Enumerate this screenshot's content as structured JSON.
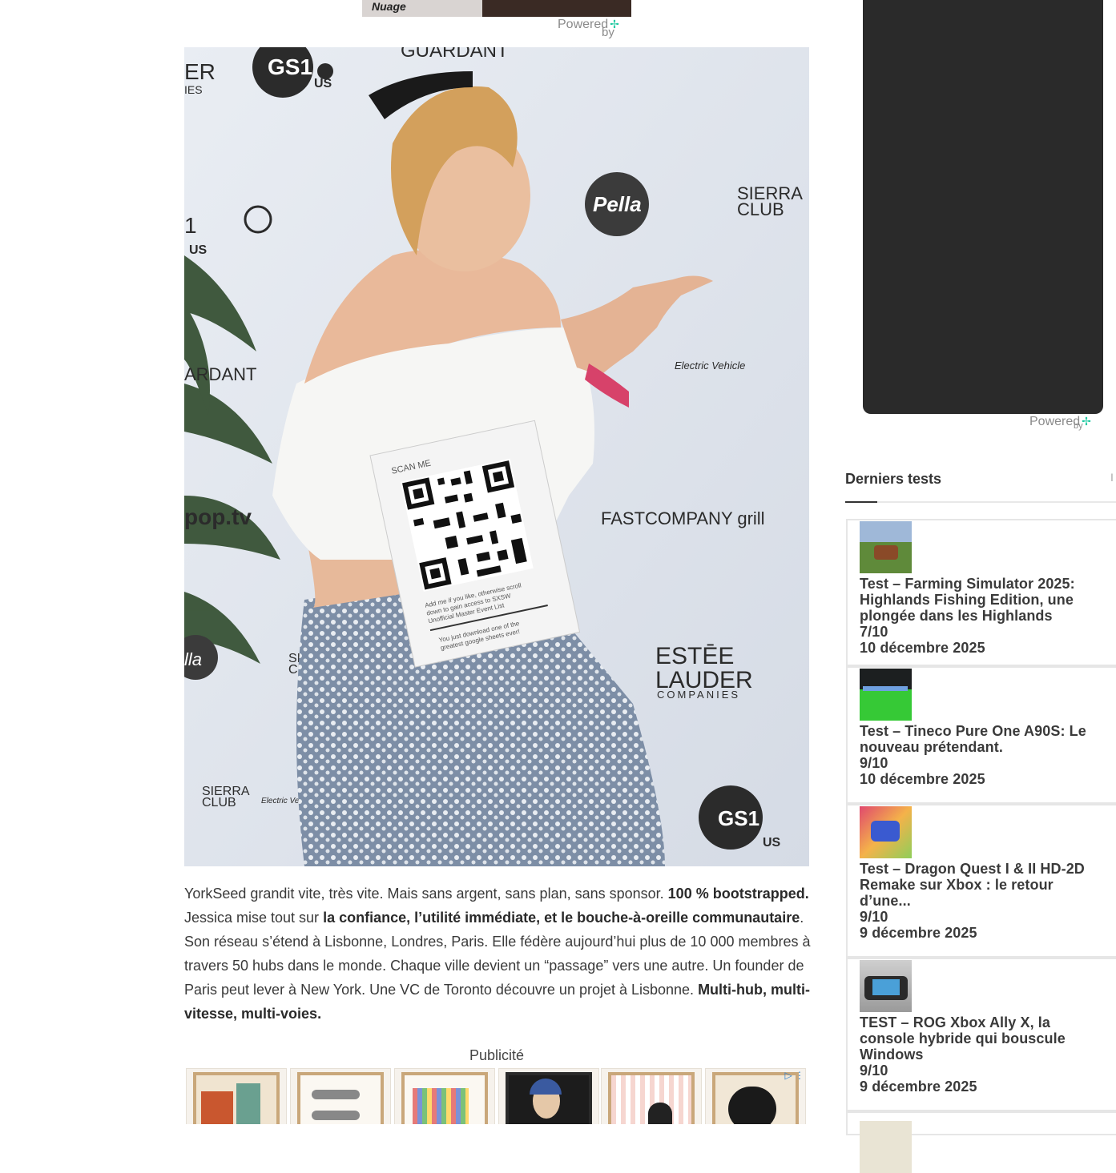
{
  "top_ad": {
    "caption": "Nuage",
    "powered_label": "Powered",
    "by_label": "by"
  },
  "photo": {
    "alt": "",
    "qr_sign": {
      "heading": "SCAN ME",
      "line1": "Add me if you like, otherwise scroll",
      "line2": "down to gain access to SXSW",
      "line3": "Unofficial Master Event List",
      "line4": "You just download one of the",
      "line5": "greatest google sheets ever!"
    },
    "backdrop_logos": [
      "GS1",
      "US",
      "GUARDANT",
      "Pella",
      "SIERRA",
      "CLUB",
      "tv",
      "Electric Vehicle",
      "FASTCOMPANY grill",
      "ESTĒE",
      "LAUDER",
      "COMPANIES",
      "pop.tv",
      "ER",
      "IES",
      "1",
      "US",
      "ARDANT",
      "lla",
      "SIERRA",
      "CLUB",
      "SIERRA",
      "CLUB",
      "GS1",
      "US",
      "icle",
      "Electric Ve"
    ]
  },
  "article": {
    "p1_a": "YorkSeed grandit vite, très vite. Mais sans argent, sans plan, sans sponsor. ",
    "p1_b": "100 % bootstrapped.",
    "p1_c": " Jessica mise tout sur ",
    "p1_d": "la confiance, l’utilité immédiate, et le bouche-à-oreille communautaire",
    "p1_e": ". Son réseau s’étend à Lisbonne, Londres, Paris. Elle fédère aujourd’hui plus de 10 000 membres à travers 50 hubs dans le monde. Chaque ville devient un “passage” vers une autre. Un founder de Paris peut lever à New York. Une VC de Toronto découvre un projet à Lisbonne. ",
    "p1_f": "Multi-hub, multi-vitesse, multi-voies."
  },
  "publicite": {
    "label": "Publicité",
    "adchoice": "▷ ⋮"
  },
  "sidebar": {
    "video_powered": "Powered",
    "video_by": "by",
    "section_title": "Derniers tests",
    "scroll_hint": "I",
    "reviews": [
      {
        "title": "Test – Farming Simulator 2025: Highlands Fishing Edition, une plongée dans les Highlands",
        "score": "7/10",
        "date": "10 décembre 2025"
      },
      {
        "title": "Test – Tineco Pure One A90S: Le nouveau prétendant.",
        "score": "9/10",
        "date": "10 décembre 2025"
      },
      {
        "title": "Test – Dragon Quest I & II HD-2D Remake sur Xbox : le retour d’une...",
        "score": "9/10",
        "date": "9 décembre 2025"
      },
      {
        "title": "TEST – ROG Xbox Ally X, la console hybride qui bouscule Windows",
        "score": "9/10",
        "date": "9 décembre 2025"
      }
    ]
  },
  "colors": {
    "accent_plus": "#1ec8a0",
    "dark_video": "#2a2a2a",
    "text": "#3a3a3a"
  }
}
